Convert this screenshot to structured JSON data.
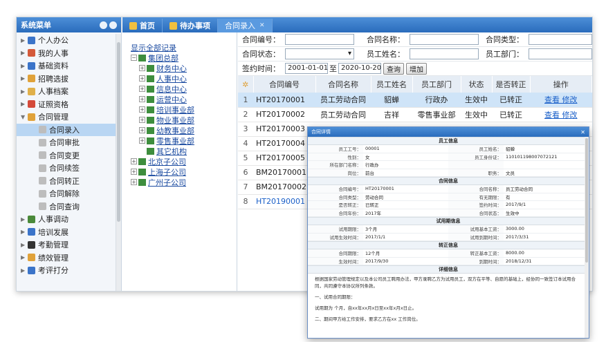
{
  "sidebar": {
    "title": "系统菜单",
    "items": [
      {
        "label": "个人办公",
        "icon": "person-icon",
        "color": "#3b74c9"
      },
      {
        "label": "我的人事",
        "icon": "contact-icon",
        "color": "#d45a3a"
      },
      {
        "label": "基础资料",
        "icon": "book-icon",
        "color": "#3b74c9"
      },
      {
        "label": "招聘选拔",
        "icon": "megaphone-icon",
        "color": "#e0a23a"
      },
      {
        "label": "人事档案",
        "icon": "folder-icon",
        "color": "#e0b04a"
      },
      {
        "label": "证照资格",
        "icon": "medal-icon",
        "color": "#d44a3a"
      },
      {
        "label": "合同管理",
        "icon": "contract-icon",
        "color": "#e0a23a"
      }
    ],
    "subitems": [
      "合同录入",
      "合同审批",
      "合同变更",
      "合同续签",
      "合同转正",
      "合同解除",
      "合同查询"
    ],
    "items2": [
      {
        "label": "人事调动",
        "icon": "people-icon",
        "color": "#4a8a3a"
      },
      {
        "label": "培训发展",
        "icon": "training-icon",
        "color": "#3b74c9"
      },
      {
        "label": "考勤管理",
        "icon": "clock-icon",
        "color": "#333333"
      },
      {
        "label": "绩效管理",
        "icon": "key-icon",
        "color": "#e0a23a"
      },
      {
        "label": "考评打分",
        "icon": "chart-icon",
        "color": "#3b74c9"
      }
    ]
  },
  "tabs": [
    "首页",
    "待办事项",
    "合同录入"
  ],
  "tree": {
    "show_all": "显示全部记录",
    "root": "集团总部",
    "nodes": [
      "财务中心",
      "人事中心",
      "信息中心",
      "运营中心",
      "培训事业部",
      "物业事业部",
      "幼教事业部",
      "零售事业部",
      "其它机构"
    ],
    "others": [
      "北京子公司",
      "上海子公司",
      "广州子公司"
    ]
  },
  "filters": {
    "contract_no": "合同编号：",
    "contract_name": "合同名称：",
    "contract_type": "合同类型：",
    "contract_status": "合同状态：",
    "employee_name": "员工姓名：",
    "employee_dept": "员工部门：",
    "sign_date": "签约时间：",
    "date_from": "2001-01-01",
    "to": "至",
    "date_to": "2020-10-20",
    "query_btn": "查询",
    "add_btn": "增加"
  },
  "table": {
    "headers": [
      "合同编号",
      "合同名称",
      "员工姓名",
      "员工部门",
      "状态",
      "是否转正",
      "操作"
    ],
    "rows": [
      {
        "n": "1",
        "code": "HT20170001",
        "name": "员工劳动合同",
        "emp": "貂蝉",
        "dept": "行政办",
        "status": "生效中",
        "formal": "已转正",
        "op": "查看 修改"
      },
      {
        "n": "2",
        "code": "HT20170002",
        "name": "员工劳动合同",
        "emp": "吉祥",
        "dept": "零售事业部",
        "status": "生效中",
        "formal": "已转正",
        "op": "查看 修改"
      },
      {
        "n": "3",
        "code": "HT20170003",
        "name": "",
        "emp": "",
        "dept": "",
        "status": "",
        "formal": "",
        "op": ""
      },
      {
        "n": "4",
        "code": "HT20170004",
        "name": "",
        "emp": "",
        "dept": "",
        "status": "",
        "formal": "",
        "op": ""
      },
      {
        "n": "5",
        "code": "HT20170005",
        "name": "",
        "emp": "",
        "dept": "",
        "status": "",
        "formal": "",
        "op": ""
      },
      {
        "n": "6",
        "code": "BM20170001",
        "name": "",
        "emp": "",
        "dept": "",
        "status": "",
        "formal": "",
        "op": ""
      },
      {
        "n": "7",
        "code": "BM20170002",
        "name": "",
        "emp": "",
        "dept": "",
        "status": "",
        "formal": "",
        "op": ""
      },
      {
        "n": "8",
        "code": "HT20190001",
        "name": "",
        "emp": "",
        "dept": "",
        "status": "",
        "formal": "",
        "op": ""
      }
    ]
  },
  "modal": {
    "title": "合同详情",
    "sec_emp": "员工信息",
    "emp": [
      [
        "员工工号：",
        "00001",
        "员工姓名：",
        "貂蝉"
      ],
      [
        "性别：",
        "女",
        "员工身份证：",
        "110101198007072121"
      ],
      [
        "所在部门名称：",
        "行政办",
        "",
        ""
      ],
      [
        "岗位：",
        "前台",
        "职务：",
        "文员"
      ]
    ],
    "sec_contract": "合同信息",
    "contract": [
      [
        "合同编号：",
        "HT20170001",
        "合同名称：",
        "员工劳动合同"
      ],
      [
        "合同类型：",
        "劳动合同",
        "有无期限：",
        "有"
      ],
      [
        "是否转正：",
        "已转正",
        "签约时间：",
        "2017/9/1"
      ],
      [
        "合同年份：",
        "2017年",
        "合同状态：",
        "生效中"
      ]
    ],
    "sec_trial": "试用期信息",
    "trial": [
      [
        "试用期限：",
        "3个月",
        "试用基本工资：",
        "3000.00"
      ],
      [
        "试用生效时间：",
        "2017/1/1",
        "试用到期时间：",
        "2017/3/31"
      ]
    ],
    "sec_formal": "转正信息",
    "formal": [
      [
        "合同期限：",
        "12个月",
        "转正基本工资：",
        "8000.00"
      ],
      [
        "生效时间：",
        "2017/9/30",
        "到期时间：",
        "2018/12/31"
      ]
    ],
    "sec_detail": "详细信息",
    "detail_p1": "根据国家劳动管理规定以及本公司员工聘用办法，甲方录聘乙方为试用员工，双方在平等、自愿的基础上，经协同一致签订本试用合同，共同遵守本协议所列条款。",
    "detail_p2": "一、试用合同期限：",
    "detail_p3": "试用期为 个月，自xx年xx月x日至xx年x月x日止。",
    "detail_p4": "二、期间甲方给工作安排，要求乙方在xx 工作岗位。"
  }
}
